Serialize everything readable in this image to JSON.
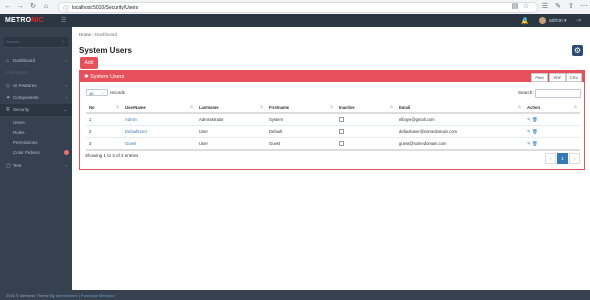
{
  "browser": {
    "url": "localhost:5010/Security/Users",
    "icons": [
      "back-icon",
      "forward-icon",
      "reload-icon",
      "home-icon",
      "lock-icon",
      "reader-icon",
      "star-icon",
      "extensions-icon",
      "pen-icon",
      "share-icon",
      "menu-icon"
    ]
  },
  "header": {
    "brand_main": "METRO",
    "brand_accent": "NIC",
    "notification_count": "1",
    "user_name": "admin"
  },
  "sidebar": {
    "search_placeholder": "Search...",
    "items": [
      {
        "label": "Dashboard"
      },
      {
        "label": "UI Features"
      },
      {
        "label": "Components"
      },
      {
        "label": "Security"
      },
      {
        "label": "Test"
      }
    ],
    "heading": "FEATURES",
    "security_subitems": [
      {
        "label": "Users"
      },
      {
        "label": "Roles"
      },
      {
        "label": "Permissions"
      },
      {
        "label": "Color Pickers"
      }
    ]
  },
  "breadcrumb": {
    "home": "Home",
    "current": "Dashboard"
  },
  "page": {
    "title": "System Users",
    "add_label": "Add"
  },
  "portlet": {
    "title": "System Users",
    "tools": [
      "Print",
      "PDF",
      "CSV"
    ]
  },
  "table_controls": {
    "page_length": "10",
    "records_label": "records",
    "search_label": "Search:"
  },
  "table": {
    "headers": [
      "No",
      "UserName",
      "Lastname",
      "Firstname",
      "Inactive",
      "Email",
      "Action"
    ],
    "rows": [
      {
        "no": "1",
        "username": "Admin",
        "lastname": "Administrator",
        "firstname": "System",
        "email": "elboye@gmail.com"
      },
      {
        "no": "2",
        "username": "DefaultUser",
        "lastname": "User",
        "firstname": "Default",
        "email": "defaultuser@somedomain.com"
      },
      {
        "no": "3",
        "username": "Guest",
        "lastname": "User",
        "firstname": "Guest",
        "email": "guest@somedomain.com"
      }
    ]
  },
  "pagination": {
    "info": "Showing 1 to 3 of 3 entries",
    "prev": "‹",
    "current": "1",
    "next": "›"
  },
  "footer": {
    "text": "2016 © Metronic Theme By",
    "link1": "keenthemes",
    "separator": "|",
    "link2": "Purchase Metronic!"
  },
  "colors": {
    "accent": "#e7505a",
    "sidebar": "#364150",
    "header": "#2b3643",
    "link": "#337ab7"
  }
}
